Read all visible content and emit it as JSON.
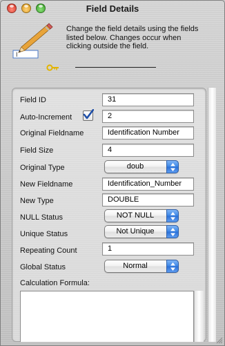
{
  "window": {
    "title": "Field Details"
  },
  "info": {
    "text": "Change the field details using the fields listed below. Changes occur when clicking outside the field.",
    "pencil_field_value": "I"
  },
  "fields": {
    "field_id": {
      "label": "Field ID",
      "value": "31"
    },
    "auto_increment": {
      "label": "Auto-Increment",
      "value": "2",
      "checked": true
    },
    "original_fieldname": {
      "label": "Original Fieldname",
      "value": "Identification Number"
    },
    "field_size": {
      "label": "Field Size",
      "value": "4"
    },
    "original_type": {
      "label": "Original Type",
      "value": "doub"
    },
    "new_fieldname": {
      "label": "New Fieldname",
      "value": "Identification_Number"
    },
    "new_type": {
      "label": "New Type",
      "value": "DOUBLE"
    },
    "null_status": {
      "label": "NULL Status",
      "value": "NOT NULL"
    },
    "unique_status": {
      "label": "Unique Status",
      "value": "Not Unique"
    },
    "repeating_count": {
      "label": "Repeating Count",
      "value": "1"
    },
    "global_status": {
      "label": "Global Status",
      "value": "Normal"
    },
    "calculation_formula": {
      "label": "Calculation Formula:",
      "value": ""
    }
  },
  "icons": {
    "pencil": "pencil-icon",
    "key": "key-icon",
    "checkmark": "checkmark-icon",
    "popup_arrows": "up-down-arrows-icon"
  },
  "colors": {
    "close": "#d0281b",
    "minimize": "#d48f0a",
    "zoom": "#2e9a1c",
    "accent": "#3a85e6",
    "checkmark": "#1f4fa8",
    "key": "#e3b400"
  }
}
